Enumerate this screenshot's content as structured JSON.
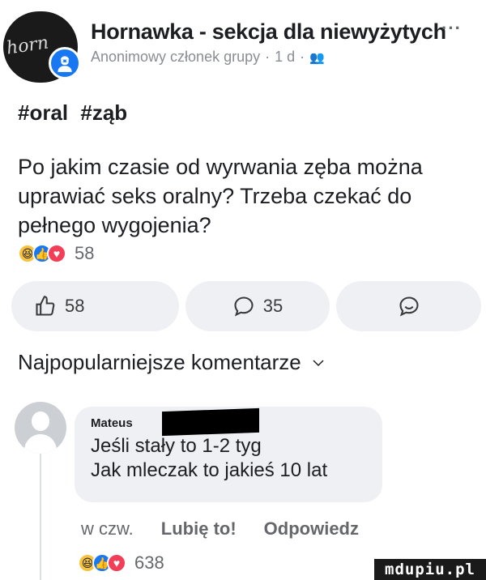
{
  "post": {
    "group_name": "Hornawka - sekcja dla niewyżytych",
    "more_label": "···",
    "author": "Anonimowy członek grupy",
    "separator": "·",
    "time": "1 d",
    "audience_icon": "group-icon",
    "hashtags": [
      "#oral",
      "#ząb"
    ],
    "body": "Po jakim czasie od wyrwania zęba można uprawiać seks oralny? Trzeba czekać do pełnego wygojenia?",
    "reactions": {
      "icons": [
        "haha",
        "like",
        "love"
      ],
      "count": "58"
    }
  },
  "action_bar": {
    "like_count": "58",
    "comment_count": "35",
    "share_icon": "share-icon"
  },
  "comments_section": {
    "sort_label": "Najpopularniejsze komentarze"
  },
  "comment": {
    "author": "Mateus",
    "lines": [
      "Jeśli stały to 1-2 tyg",
      "Jak mleczak to jakieś 10 lat"
    ],
    "time": "w czw.",
    "like_label": "Lubię to!",
    "reply_label": "Odpowiedz",
    "reactions": {
      "icons": [
        "haha",
        "like",
        "love"
      ],
      "count": "638"
    }
  },
  "watermark": "mdupiu.pl",
  "colors": {
    "accent": "#1877f2",
    "bubble": "#eef0f3",
    "muted": "#65676b"
  }
}
